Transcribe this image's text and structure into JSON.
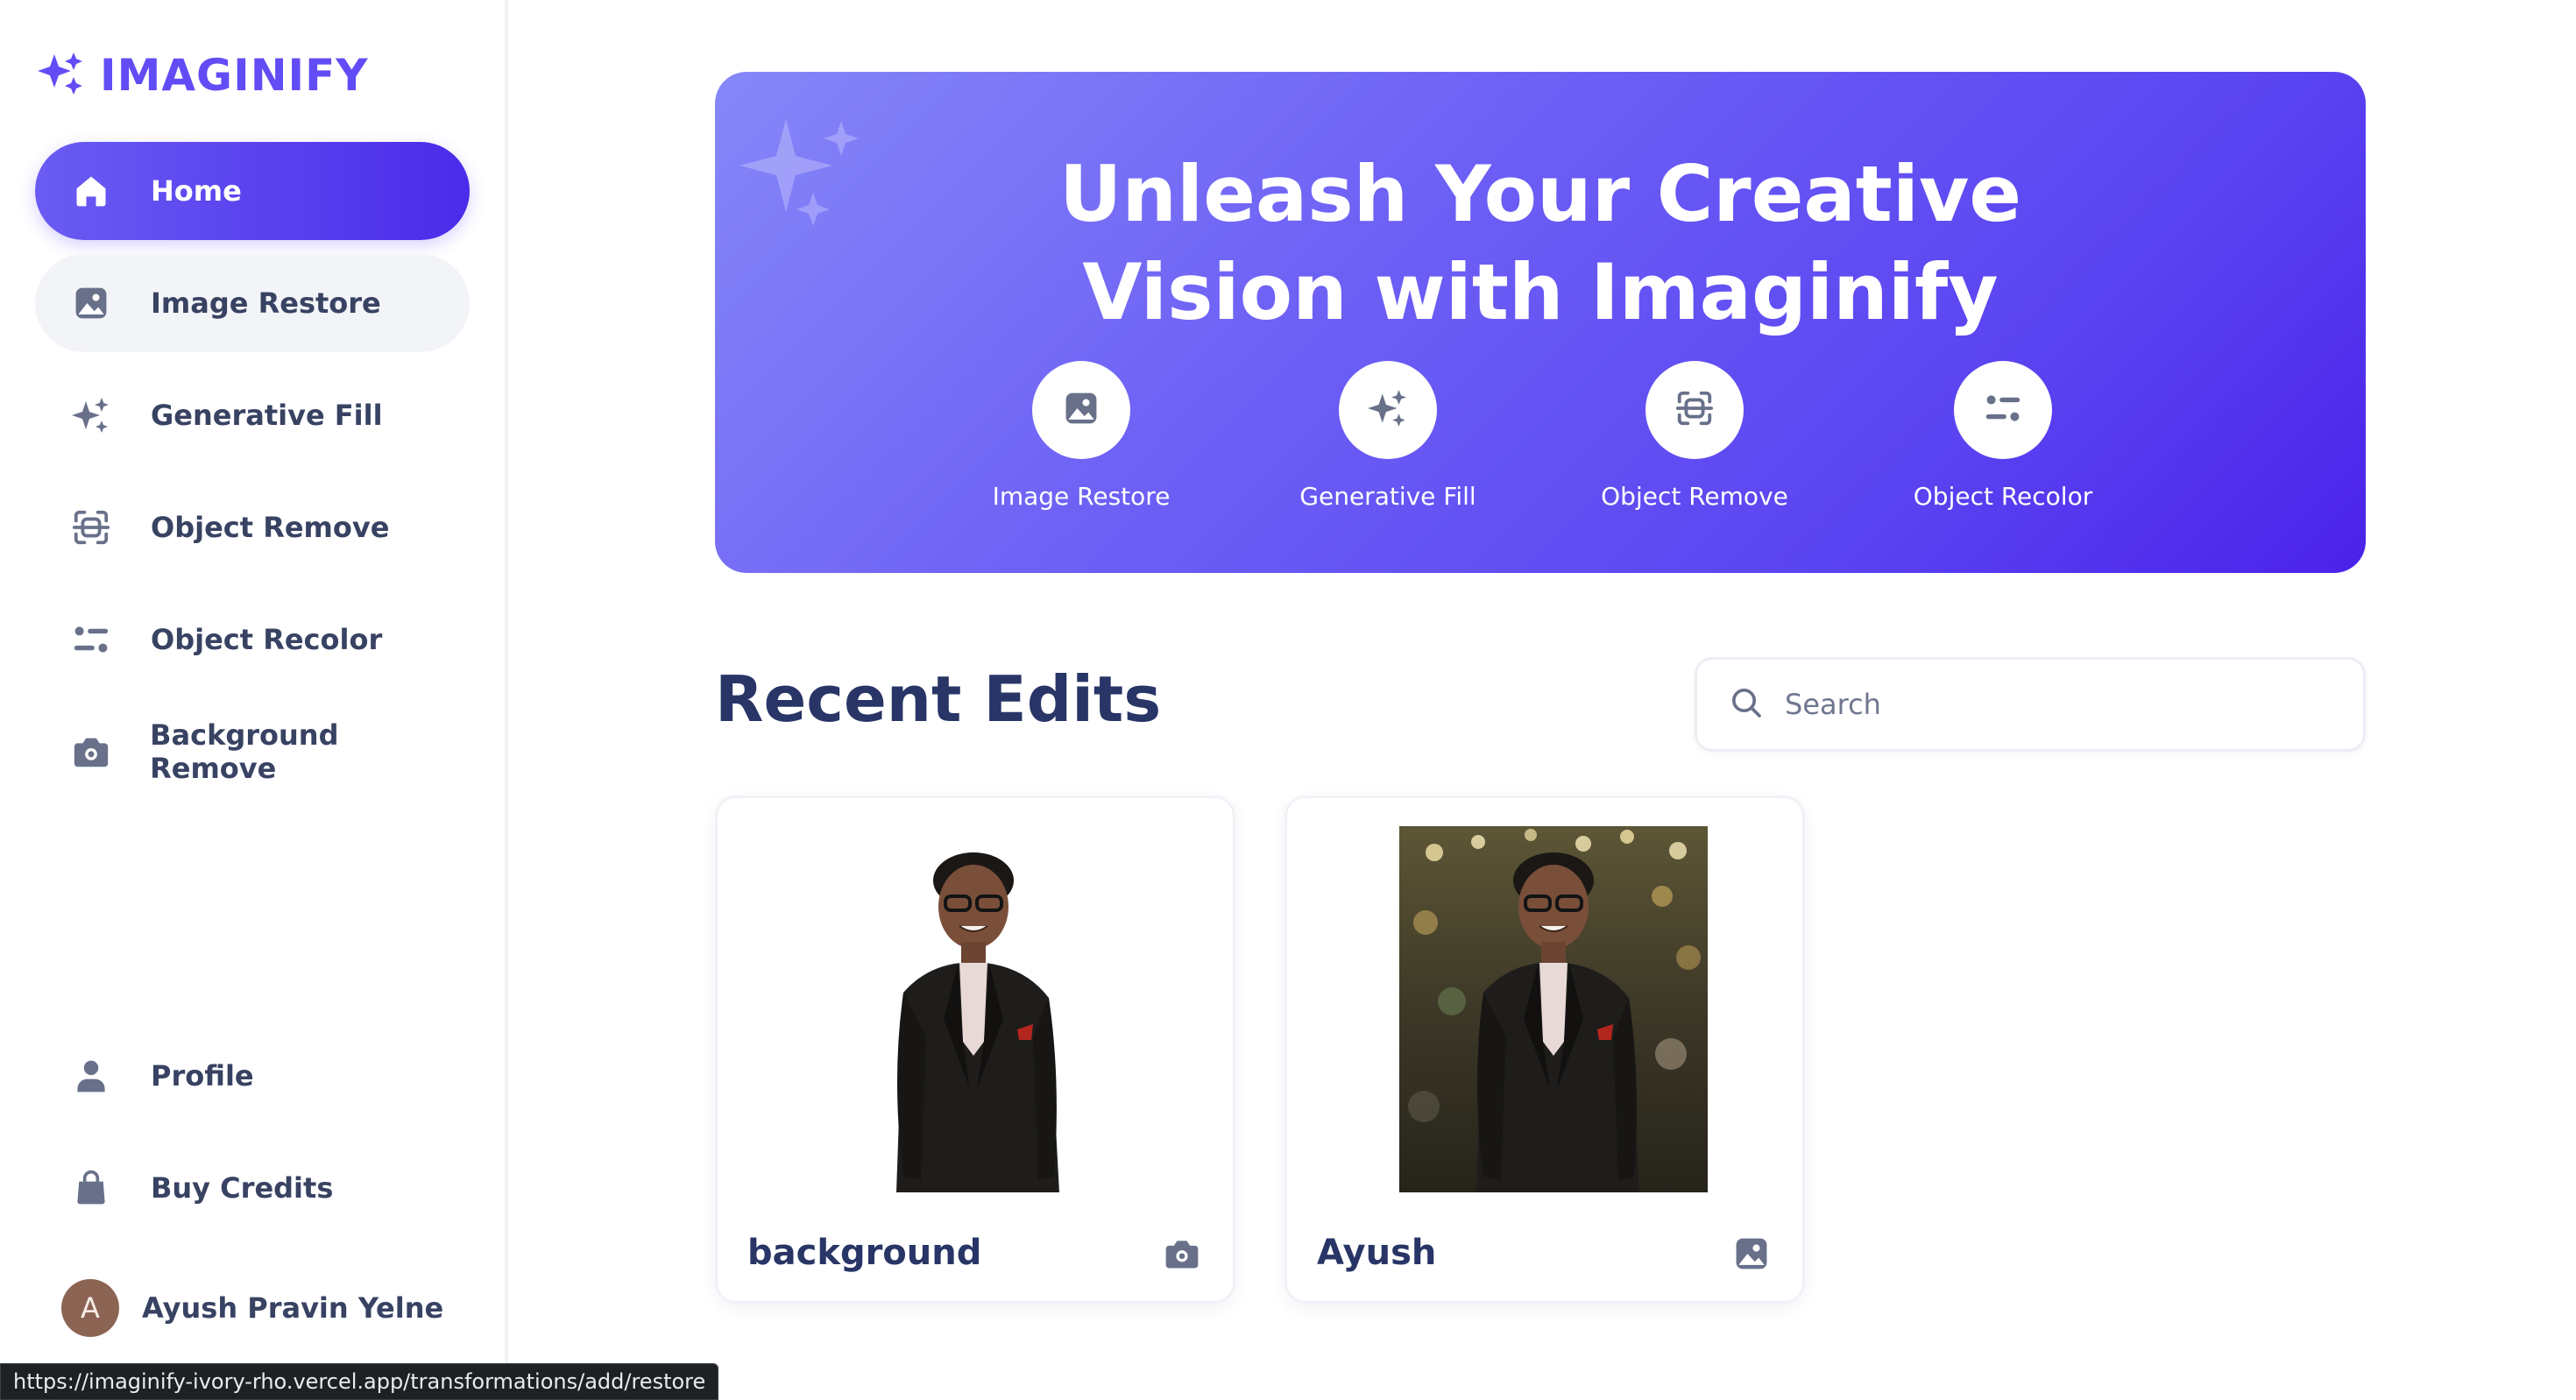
{
  "brand": {
    "name": "IMAGINIFY",
    "icon": "sparkles-logo-icon",
    "color": "#624cf5"
  },
  "sidebar": {
    "items": [
      {
        "label": "Home",
        "icon": "home-icon",
        "state": "active"
      },
      {
        "label": "Image Restore",
        "icon": "image-icon",
        "state": "hover"
      },
      {
        "label": "Generative Fill",
        "icon": "sparkles-icon"
      },
      {
        "label": "Object Remove",
        "icon": "scan-icon"
      },
      {
        "label": "Object Recolor",
        "icon": "filter-icon"
      },
      {
        "label": "Background Remove",
        "icon": "camera-icon"
      }
    ],
    "bottom_items": [
      {
        "label": "Profile",
        "icon": "user-icon"
      },
      {
        "label": "Buy Credits",
        "icon": "bag-icon"
      }
    ],
    "user": {
      "initial": "A",
      "name": "Ayush Pravin Yelne"
    }
  },
  "hero": {
    "title_line1": "Unleash Your Creative",
    "title_line2": "Vision with Imaginify",
    "features": [
      {
        "label": "Image Restore",
        "icon": "image-icon"
      },
      {
        "label": "Generative Fill",
        "icon": "sparkles-icon"
      },
      {
        "label": "Object Remove",
        "icon": "scan-icon"
      },
      {
        "label": "Object Recolor",
        "icon": "filter-icon"
      }
    ]
  },
  "recent": {
    "title": "Recent Edits",
    "search_placeholder": "Search",
    "cards": [
      {
        "title": "background",
        "icon": "camera-icon",
        "image": "person-cutout"
      },
      {
        "title": "Ayush",
        "icon": "image-icon",
        "image": "person-with-background"
      }
    ]
  },
  "status_url": "https://imaginify-ivory-rho.vercel.app/transformations/add/restore",
  "colors": {
    "accent": "#624cf5",
    "text": "#384262",
    "heading": "#283566"
  }
}
